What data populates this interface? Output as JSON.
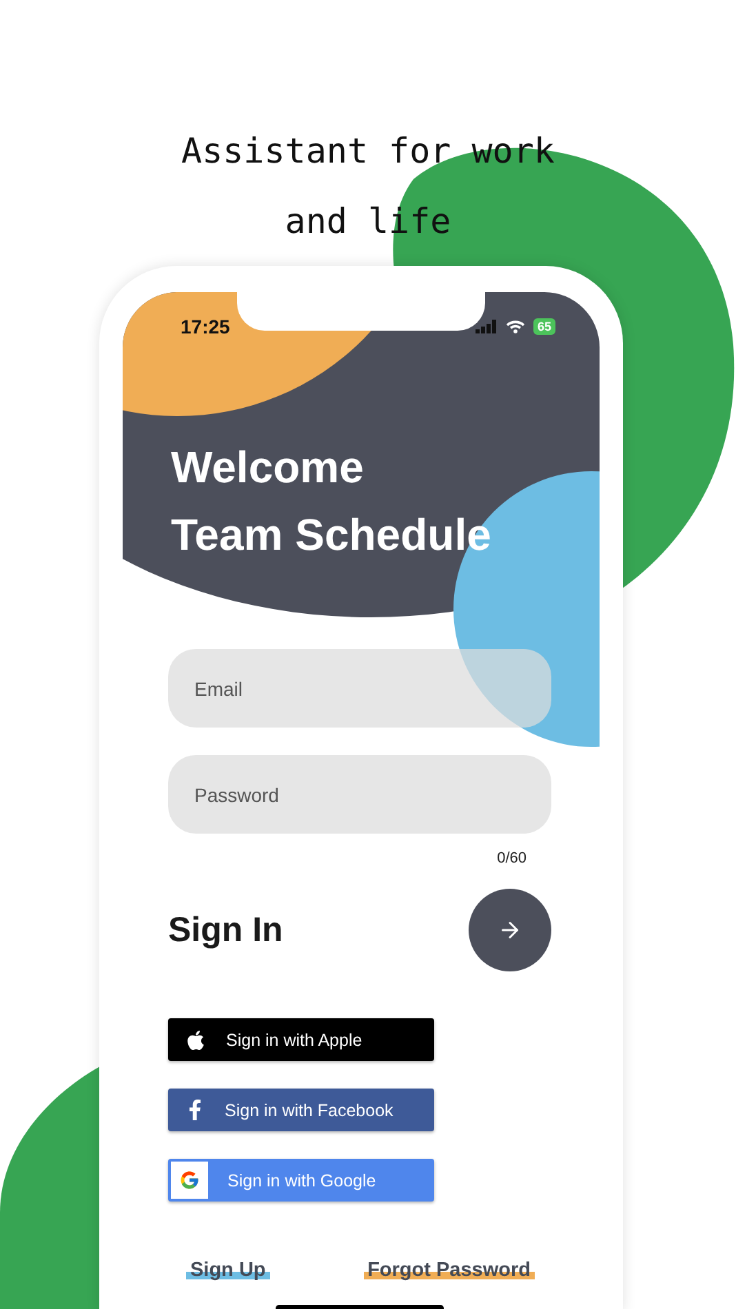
{
  "headline": [
    "Assistant for work",
    "and life"
  ],
  "status_bar": {
    "time": "17:25",
    "battery": "65"
  },
  "header": {
    "lines": [
      "Welcome",
      "Team Schedule"
    ]
  },
  "fields": [
    {
      "placeholder": "Email"
    },
    {
      "placeholder": "Password"
    }
  ],
  "counter": "0/60",
  "sign_in": {
    "title": "Sign In"
  },
  "social_buttons": [
    {
      "kind": "apple",
      "label": "Sign in with Apple"
    },
    {
      "kind": "facebook",
      "label": "Sign in with Facebook"
    },
    {
      "kind": "google",
      "label": "Sign in with Google"
    }
  ],
  "links": [
    {
      "label": "Sign Up",
      "color": "#6dbde3"
    },
    {
      "label": "Forgot Password",
      "color": "#f0ad55"
    }
  ]
}
